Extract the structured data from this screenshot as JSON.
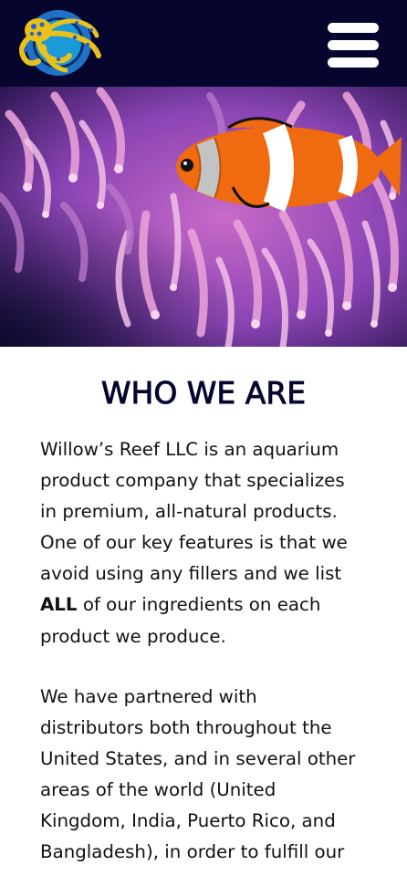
{
  "header": {
    "background": "#05052e",
    "logo_icon": "octopus-logo-icon",
    "menu_icon": "hamburger-menu-icon"
  },
  "hero": {
    "subject": "clownfish-in-anemone-image"
  },
  "about": {
    "title": "WHO WE ARE",
    "paragraph_1": {
      "lines": [
        "Willow’s Reef LLC is an aquarium",
        "product company that specializes",
        "in premium, all-natural products.",
        "One of our key features is that we",
        "avoid using any fillers and we list"
      ],
      "line_6_bold": "ALL",
      "line_6_rest": " of our ingredients on each",
      "line_7": "product we produce."
    },
    "paragraph_2": {
      "lines": [
        "We have partnered with",
        "distributors both throughout the",
        "United States, and in several other",
        "areas of the world (United",
        "Kingdom, India, Puerto Rico, and",
        "Bangladesh), in order to fulfill our"
      ]
    }
  }
}
